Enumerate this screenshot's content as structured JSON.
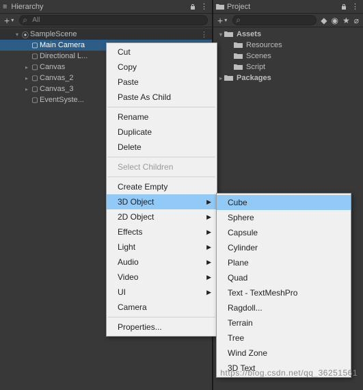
{
  "hierarchy": {
    "title": "Hierarchy",
    "search_placeholder": "All",
    "scene": "SampleScene",
    "items": [
      {
        "label": "Main Camera"
      },
      {
        "label": "Directional L..."
      },
      {
        "label": "Canvas",
        "expandable": true
      },
      {
        "label": "Canvas_2",
        "expandable": true
      },
      {
        "label": "Canvas_3",
        "expandable": true
      },
      {
        "label": "EventSyste..."
      }
    ]
  },
  "project": {
    "title": "Project",
    "items": [
      {
        "label": "Assets",
        "depth": 0,
        "expanded": true,
        "bold": true
      },
      {
        "label": "Resources",
        "depth": 1
      },
      {
        "label": "Scenes",
        "depth": 1
      },
      {
        "label": "Script",
        "depth": 1
      },
      {
        "label": "Packages",
        "depth": 0,
        "expandable": true,
        "bold": true
      }
    ]
  },
  "context_menu": {
    "items": [
      {
        "label": "Cut"
      },
      {
        "label": "Copy"
      },
      {
        "label": "Paste"
      },
      {
        "label": "Paste As Child"
      },
      {
        "sep": true
      },
      {
        "label": "Rename"
      },
      {
        "label": "Duplicate"
      },
      {
        "label": "Delete"
      },
      {
        "sep": true
      },
      {
        "label": "Select Children",
        "disabled": true
      },
      {
        "sep": true
      },
      {
        "label": "Create Empty"
      },
      {
        "label": "3D Object",
        "submenu": true,
        "hl": true
      },
      {
        "label": "2D Object",
        "submenu": true
      },
      {
        "label": "Effects",
        "submenu": true
      },
      {
        "label": "Light",
        "submenu": true
      },
      {
        "label": "Audio",
        "submenu": true
      },
      {
        "label": "Video",
        "submenu": true
      },
      {
        "label": "UI",
        "submenu": true
      },
      {
        "label": "Camera"
      },
      {
        "sep": true
      },
      {
        "label": "Properties..."
      }
    ]
  },
  "submenu": {
    "items": [
      {
        "label": "Cube",
        "hl": true
      },
      {
        "label": "Sphere"
      },
      {
        "label": "Capsule"
      },
      {
        "label": "Cylinder"
      },
      {
        "label": "Plane"
      },
      {
        "label": "Quad"
      },
      {
        "label": "Text - TextMeshPro"
      },
      {
        "label": "Ragdoll..."
      },
      {
        "label": "Terrain"
      },
      {
        "label": "Tree"
      },
      {
        "label": "Wind Zone"
      },
      {
        "label": "3D Text"
      }
    ]
  },
  "watermark": "https://blog.csdn.net/qq_36251561"
}
